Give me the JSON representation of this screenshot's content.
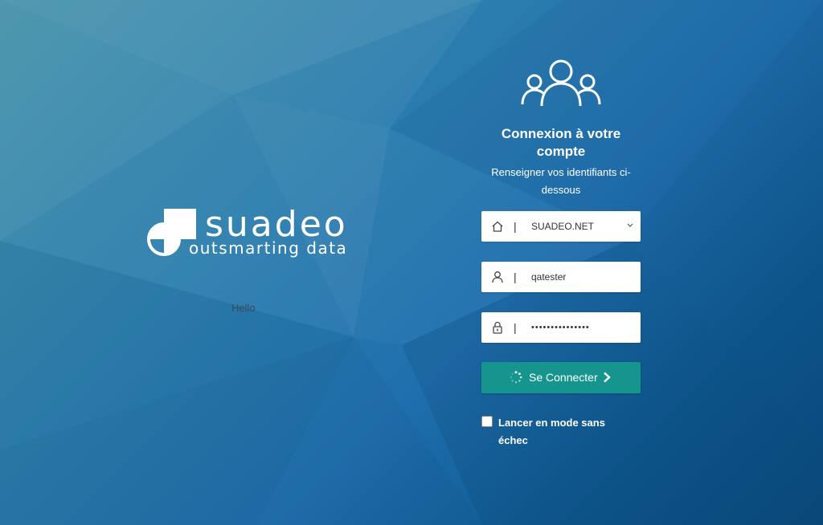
{
  "brand": {
    "name": "suadeo",
    "tagline": "outsmarting data"
  },
  "hello_text": "Hello",
  "login": {
    "title": "Connexion à votre compte",
    "subtitle": "Renseigner vos identifiants ci-dessous",
    "domain_field": {
      "icon": "home-icon",
      "separator": "|",
      "value": "SUADEO.NET"
    },
    "username_field": {
      "icon": "user-icon",
      "separator": "|",
      "value": "qatester"
    },
    "password_field": {
      "icon": "lock-icon",
      "separator": "|",
      "value": "•••••••••••••••"
    },
    "submit": {
      "label": "Se Connecter",
      "icon": "spinner-icon",
      "trailing_icon": "chevron-right-icon",
      "color": "#16958f"
    },
    "safe_mode": {
      "label": "Lancer en mode sans échec",
      "checked": false
    }
  }
}
